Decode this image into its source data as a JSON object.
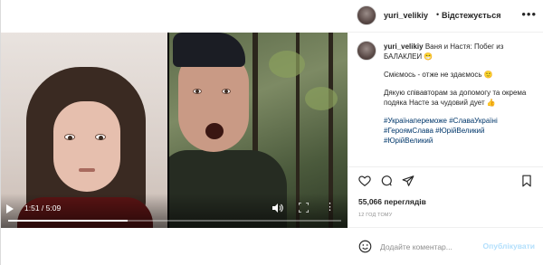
{
  "post": {
    "username": "yuri_velikiy",
    "follow_label": "Відстежується",
    "header_dot": "•",
    "more_label": "•••"
  },
  "video": {
    "time": "1:51 / 5:09",
    "progress": 0.359,
    "more_label": "⋮"
  },
  "caption": {
    "username": "yuri_velikiy",
    "title": "Ваня и Настя: Побег из БАЛАКЛЕИ 😁",
    "line1": "Сміємось - отже не здаємось 🙂",
    "line2": "Дякую співавторам за допомогу та окрема подяка Насте за чудовий дует 👍",
    "tags": "#Українапереможе #СлаваУкраїні #ГероямСлава #ЮрійВеликий #ЮрійВеликий"
  },
  "stats": {
    "views": "55,066 переглядів",
    "time_ago": "12 ГОД ТОМУ"
  },
  "comment": {
    "placeholder": "Додайте коментар...",
    "publish_label": "Опублікувати"
  },
  "colors": {
    "link": "#00376b",
    "publish_disabled": "#b2dffc",
    "muted": "#8e8e8e"
  },
  "icons": [
    "heart-icon",
    "comment-icon",
    "share-icon",
    "bookmark-icon",
    "emoji-icon",
    "play-icon",
    "volume-icon",
    "fullscreen-icon"
  ]
}
